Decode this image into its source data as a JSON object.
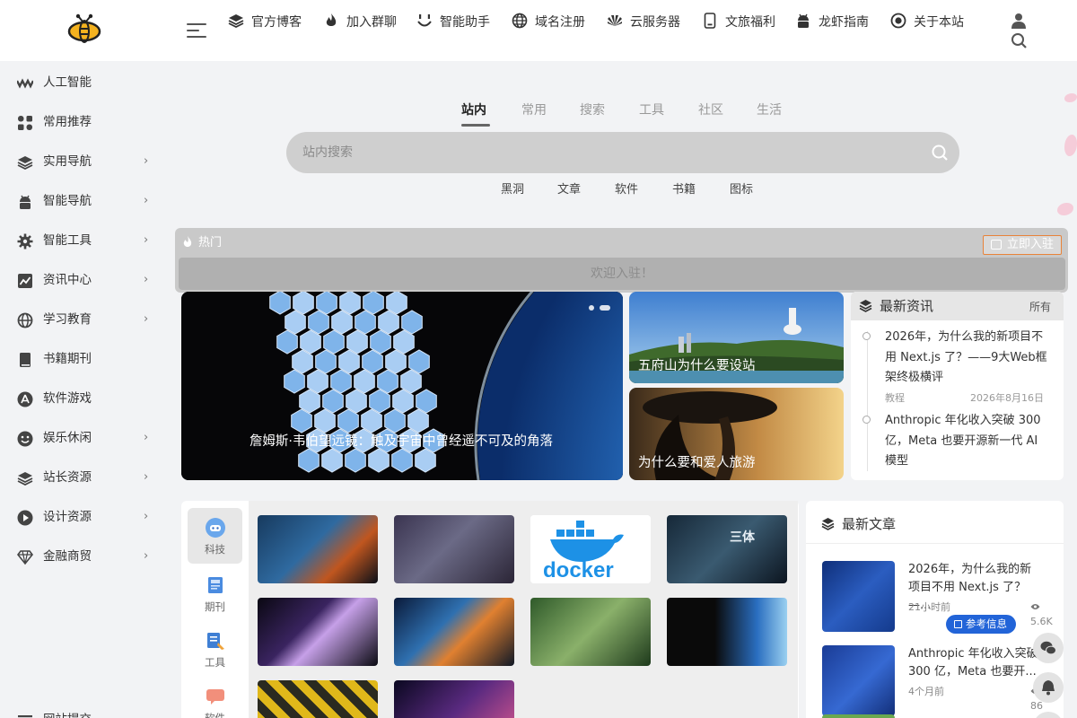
{
  "header": {
    "nav": [
      {
        "label": "官方博客",
        "icon": "layers-icon"
      },
      {
        "label": "加入群聊",
        "icon": "flame-icon"
      },
      {
        "label": "智能助手",
        "icon": "smile-icon"
      },
      {
        "label": "域名注册",
        "icon": "globe-icon"
      },
      {
        "label": "云服务器",
        "icon": "huawei-icon"
      },
      {
        "label": "文旅福利",
        "icon": "phone-icon"
      },
      {
        "label": "龙虾指南",
        "icon": "android-icon"
      },
      {
        "label": "关于本站",
        "icon": "target-icon"
      }
    ]
  },
  "sidebar": {
    "items": [
      {
        "label": "人工智能",
        "icon": "wave-icon",
        "has_submenu": false
      },
      {
        "label": "常用推荐",
        "icon": "grid-icon",
        "has_submenu": false
      },
      {
        "label": "实用导航",
        "icon": "layers-icon",
        "has_submenu": true
      },
      {
        "label": "智能导航",
        "icon": "android-icon",
        "has_submenu": true
      },
      {
        "label": "智能工具",
        "icon": "gear-icon",
        "has_submenu": true
      },
      {
        "label": "资讯中心",
        "icon": "chart-icon",
        "has_submenu": true
      },
      {
        "label": "学习教育",
        "icon": "globe-icon",
        "has_submenu": true
      },
      {
        "label": "书籍期刊",
        "icon": "book-icon",
        "has_submenu": false
      },
      {
        "label": "软件游戏",
        "icon": "appstore-icon",
        "has_submenu": false
      },
      {
        "label": "娱乐休闲",
        "icon": "smile-icon",
        "has_submenu": true
      },
      {
        "label": "站长资源",
        "icon": "layers-icon",
        "has_submenu": true
      },
      {
        "label": "设计资源",
        "icon": "play-icon",
        "has_submenu": true
      },
      {
        "label": "金融商贸",
        "icon": "diamond-icon",
        "has_submenu": true
      },
      {
        "label": "网站提交",
        "icon": "menu-icon",
        "has_submenu": false
      }
    ],
    "chevron": "›"
  },
  "search": {
    "tabs": [
      "站内",
      "常用",
      "搜索",
      "工具",
      "社区",
      "生活"
    ],
    "active_tab": "站内",
    "placeholder": "站内搜索",
    "value": "",
    "sub_tabs": [
      "黑洞",
      "文章",
      "软件",
      "书籍",
      "图标"
    ]
  },
  "hot": {
    "label": "热门",
    "join_label": "立即入驻",
    "welcome": "欢迎入驻！"
  },
  "featured": {
    "main_caption": "詹姆斯·韦伯望远镜：触及宇宙中曾经遥不可及的角落",
    "card_a": "五府山为什么要设站",
    "card_b": "为什么要和爱人旅游"
  },
  "news": {
    "title": "最新资讯",
    "all_label": "所有",
    "items": [
      {
        "title": "2026年，为什么我的新项目不用 Next.js 了？——9大Web框架终极横评",
        "tag": "教程",
        "date": "2026年8月16日"
      },
      {
        "title": "Anthropic 年化收入突破 300 亿，Meta 也要开源新一代 AI 模型",
        "tag": "",
        "date": ""
      }
    ]
  },
  "categories": [
    {
      "label": "科技",
      "active": true,
      "color": "#5b9be8"
    },
    {
      "label": "期刊",
      "active": false,
      "color": "#4a8be0"
    },
    {
      "label": "工具",
      "active": false,
      "color": "#3f7fd4"
    },
    {
      "label": "软件",
      "active": false,
      "color": "#f28f7b"
    }
  ],
  "thumbs": [
    {
      "alt": "planet-fire",
      "bg": "linear-gradient(135deg,#173a5e,#2f6aa0 45%,#c0561f 70%,#0a0f18)"
    },
    {
      "alt": "milky-way",
      "bg": "linear-gradient(135deg,#3a3450,#6b6a86 45%,#2b2536 100%)"
    },
    {
      "alt": "docker-logo",
      "bg": "#ffffff",
      "text": "docker"
    },
    {
      "alt": "three-body",
      "bg": "linear-gradient(135deg,#162838,#3a5a70 50%,#0c1520)",
      "text": "三体"
    },
    {
      "alt": "nebula-purple",
      "bg": "linear-gradient(135deg,#0a0812,#3a2460 40%,#c6a0e8 55%,#0a0a12)"
    },
    {
      "alt": "galaxy-fire",
      "bg": "linear-gradient(135deg,#0a1a3a,#2f70b0 40%,#e08030 60%,#101826)"
    },
    {
      "alt": "forest-mist",
      "bg": "linear-gradient(135deg,#2f5a2a,#8ab06a 50%,#1e3a1c)"
    },
    {
      "alt": "webb-mirror",
      "bg": "linear-gradient(90deg,#0a0a0a 40%,#2a6ec0 75%,#9ad0f0)"
    },
    {
      "alt": "radiation-sign",
      "bg": "repeating-linear-gradient(45deg,#e0b81a 0 10px,#2a2a20 10px 20px)"
    },
    {
      "alt": "purple-planet",
      "bg": "linear-gradient(135deg,#0a0820,#5a2a80 50%,#e05a90)"
    }
  ],
  "articles": {
    "title": "最新文章",
    "items": [
      {
        "title": "2026年，为什么我的新项目不用 Next.js 了？—...",
        "time": "21小时前",
        "views": "5.6K",
        "badge": "参考信息"
      },
      {
        "title": "Anthropic 年化收入突破 300 亿，Meta 也要开...",
        "time": "4个月前",
        "views": "86",
        "badge": ""
      }
    ]
  },
  "colors": {
    "accent_blue": "#2264d8",
    "join_border": "#e8833a"
  }
}
